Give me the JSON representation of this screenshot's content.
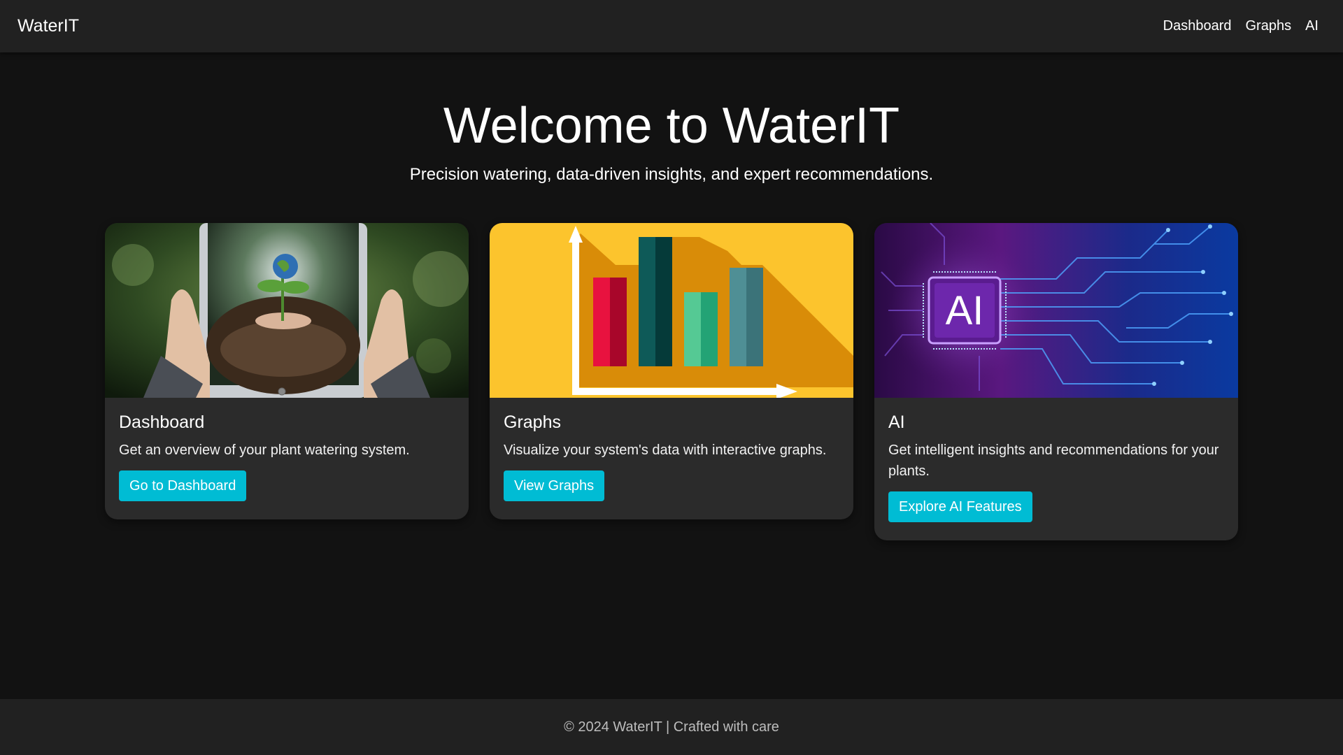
{
  "navbar": {
    "brand": "WaterIT",
    "links": [
      "Dashboard",
      "Graphs",
      "AI"
    ]
  },
  "hero": {
    "title": "Welcome to WaterIT",
    "subtitle": "Precision watering, data-driven insights, and expert recommendations."
  },
  "cards": [
    {
      "title": "Dashboard",
      "text": "Get an overview of your plant watering system.",
      "button": "Go to Dashboard"
    },
    {
      "title": "Graphs",
      "text": "Visualize your system's data with interactive graphs.",
      "button": "View Graphs"
    },
    {
      "title": "AI",
      "text": "Get intelligent insights and recommendations for your plants.",
      "button": "Explore AI Features",
      "image_text": "AI"
    }
  ],
  "footer": {
    "text": "© 2024 WaterIT | Crafted with care"
  },
  "colors": {
    "accent": "#00bcd4",
    "navbar": "#212121",
    "background": "#121212",
    "card": "#2b2b2b"
  },
  "icons": {
    "dashboard_image": "hands-holding-tablet-with-seedling",
    "graphs_image": "bar-chart-illustration",
    "ai_image": "ai-circuit-chip"
  }
}
